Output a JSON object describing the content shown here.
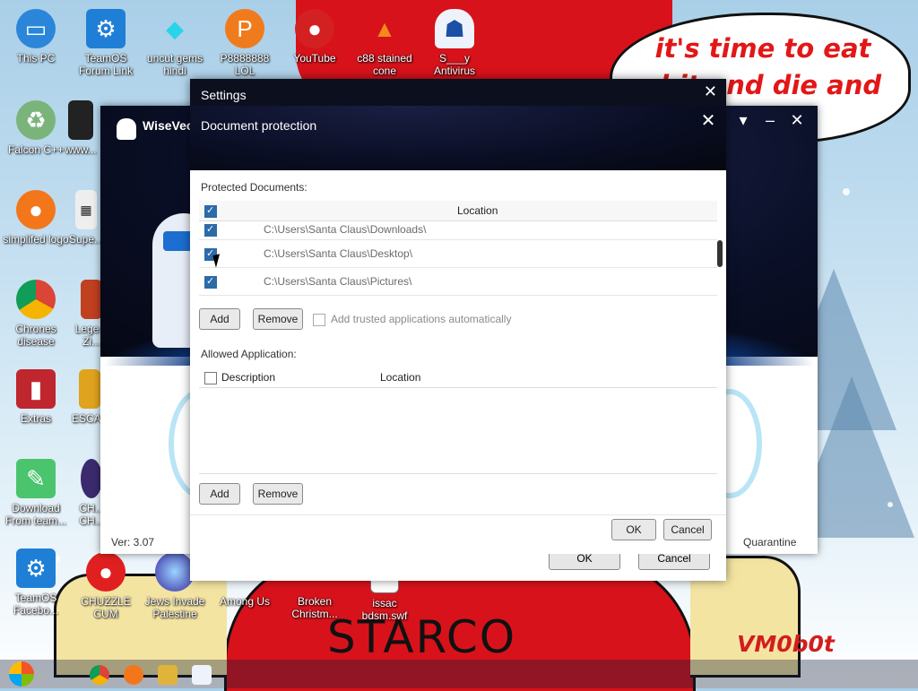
{
  "desktop": {
    "icons": [
      {
        "label": "This PC",
        "icon": "monitor-icon"
      },
      {
        "label": "TeamOS Forum Link",
        "icon": "gear-icon"
      },
      {
        "label": "uncut gems hindi",
        "icon": "gem-icon"
      },
      {
        "label": "P8888888 LOL",
        "icon": "pinball-icon"
      },
      {
        "label": "YouTube",
        "icon": "angry-bird-icon"
      },
      {
        "label": "c88 stained cone",
        "icon": "vlc-cone-icon"
      },
      {
        "label": "S___y Antivirus",
        "icon": "ghost-icon"
      },
      {
        "label": "Falcon C++",
        "icon": "recycle-icon"
      },
      {
        "label": "www...",
        "icon": "dark-icon"
      },
      {
        "label": "simplifed logo",
        "icon": "firefox-icon"
      },
      {
        "label": "Supe...",
        "icon": "pixel-icon"
      },
      {
        "label": "Chrones disease",
        "icon": "chrome-icon"
      },
      {
        "label": "Lege... Zi...",
        "icon": "mario-icon"
      },
      {
        "label": "Extras",
        "icon": "book-icon"
      },
      {
        "label": "ESCA...",
        "icon": "folder-icon"
      },
      {
        "label": "Download From team...",
        "icon": "notepad-icon"
      },
      {
        "label": "CH... CH...",
        "icon": "orb-icon"
      },
      {
        "label": "TeamOS Facebo...",
        "icon": "gear-icon"
      },
      {
        "label": "CHUZZLE CUM",
        "icon": "fuzzball-icon"
      },
      {
        "label": "Jews Invade Palestine",
        "icon": "orb-icon"
      },
      {
        "label": "Among Us",
        "icon": "among-icon"
      },
      {
        "label": "Broken Christm...",
        "icon": "broken-icon"
      },
      {
        "label": "issac bdsm.swf",
        "icon": "file-icon"
      }
    ],
    "speech_bubble": "it's time to eat shit and die and chew",
    "shirt_text": "STARCO",
    "signature": "VM0b0t"
  },
  "wisevector": {
    "title": "WiseVec",
    "version": "Ver: 3.07",
    "quarantine_label": "Quarantine",
    "ok_label": "OK",
    "cancel_label": "Cancel"
  },
  "settings": {
    "title": "Settings"
  },
  "doc_protection": {
    "title": "Document protection",
    "protected_label": "Protected Documents:",
    "location_header": "Location",
    "protected_rows": [
      {
        "location": "C:\\Users\\Santa Claus\\Downloads\\",
        "checked": true
      },
      {
        "location": "C:\\Users\\Santa Claus\\Desktop\\",
        "checked": true
      },
      {
        "location": "C:\\Users\\Santa Claus\\Pictures\\",
        "checked": true
      }
    ],
    "add_label": "Add",
    "remove_label": "Remove",
    "trusted_label": "Add trusted applications automatically",
    "allowed_label": "Allowed Application:",
    "desc_header": "Description",
    "allowed_location_header": "Location",
    "add2_label": "Add",
    "remove2_label": "Remove",
    "ok_label": "OK",
    "cancel_label": "Cancel"
  }
}
